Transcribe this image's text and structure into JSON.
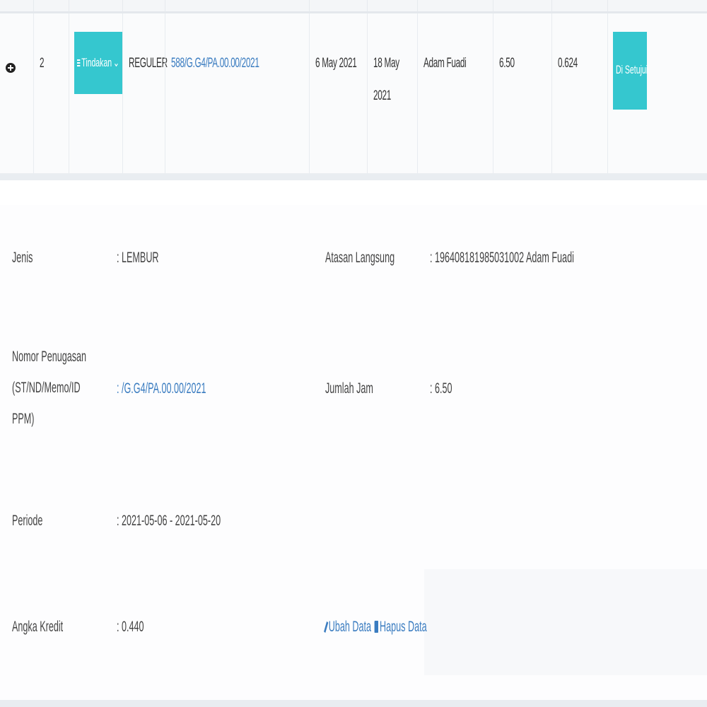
{
  "row": {
    "number": "2",
    "action_button_label": "Tindakan",
    "action_button_caret": "⌄",
    "type": "REGULER",
    "assignment_no": "588/G.G4/PA.00.00/2021",
    "start_date": "6 May 2021",
    "end_date": "18 May 2021",
    "supervisor": "Adam Fuadi",
    "hours": "6.50",
    "credit": "0.624",
    "status_button_label": "Di Setujui"
  },
  "detail": {
    "jenis_label": "Jenis",
    "jenis_value": ": LEMBUR",
    "nomor_label": "Nomor Penugasan (ST/ND/Memo/ID PPM)",
    "nomor_prefix": ": ",
    "nomor_value": "/G.G4/PA.00.00/2021",
    "periode_label": "Periode",
    "periode_value": ": 2021-05-06 - 2021-05-20",
    "angka_label": "Angka Kredit",
    "angka_value": ": 0.440",
    "atasan_label": "Atasan Langsung",
    "atasan_value": ": 196408181985031002 Adam Fuadi",
    "jumlah_label": "Jumlah Jam",
    "jumlah_value": ": 6.50",
    "edit_label": "Ubah Data",
    "delete_label": "Hapus Data"
  },
  "icons": {
    "expand": "plus-circle-icon",
    "menu": "bars-icon",
    "edit": "pencil-icon",
    "delete": "trash-icon"
  },
  "colors": {
    "accent": "#35c7cf",
    "link": "#3a7cc0"
  }
}
